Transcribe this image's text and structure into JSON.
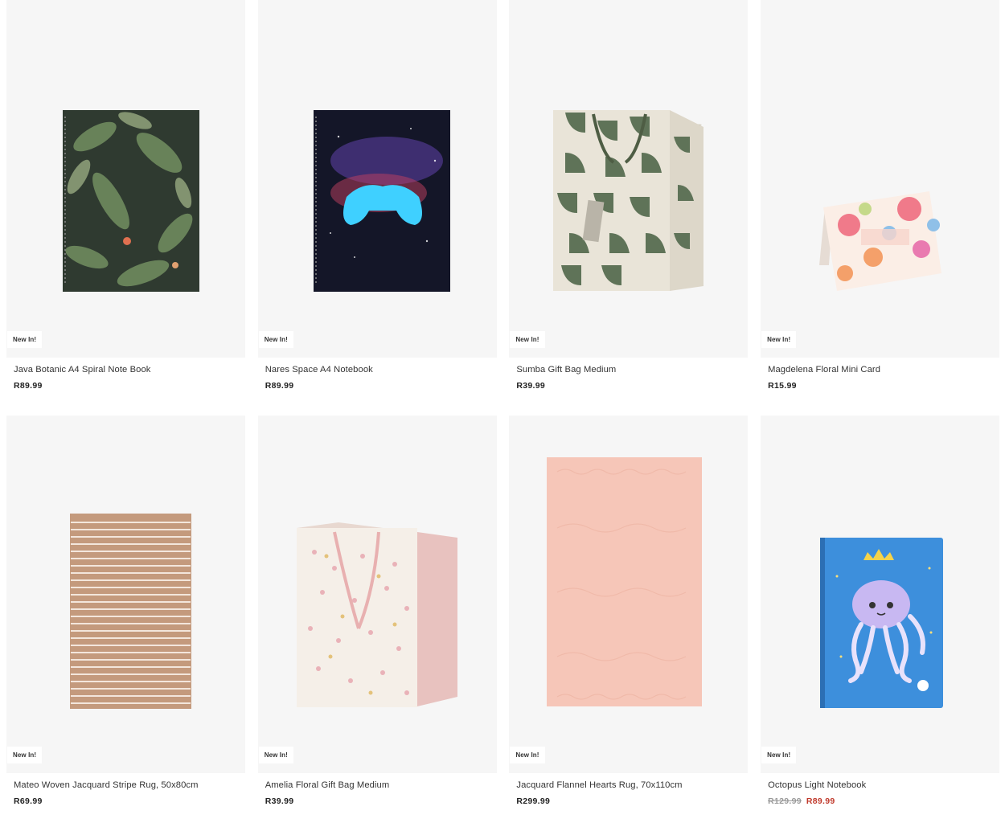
{
  "products": [
    {
      "badge": "New In!",
      "name": "Java Botanic A4 Spiral Note Book",
      "price": "R89.99",
      "was": "",
      "sale": "",
      "image": "botanic-notebook",
      "colors": {
        "cover": "#2f3a30",
        "leaf": "#6f8a5e"
      }
    },
    {
      "badge": "New In!",
      "name": "Nares Space A4 Notebook",
      "price": "R89.99",
      "was": "",
      "sale": "",
      "image": "space-gamepad-notebook",
      "colors": {
        "cover": "#141628",
        "accent": "#3fd0ff"
      }
    },
    {
      "badge": "New In!",
      "name": "Sumba Gift Bag Medium",
      "price": "R39.99",
      "was": "",
      "sale": "",
      "image": "geometric-gift-bag",
      "colors": {
        "base": "#e9e4d8",
        "pattern": "#5f7358"
      }
    },
    {
      "badge": "New In!",
      "name": "Magdelena Floral Mini Card",
      "price": "R15.99",
      "was": "",
      "sale": "",
      "image": "floral-card",
      "colors": {
        "base": "#fbeee6",
        "flower": "#f07a8a"
      }
    },
    {
      "badge": "New In!",
      "name": "Mateo Woven Jacquard Stripe Rug, 50x80cm",
      "price": "R69.99",
      "was": "",
      "sale": "",
      "image": "stripe-rug",
      "colors": {
        "base": "#c49a7d",
        "stripe": "#f3e6dc"
      }
    },
    {
      "badge": "New In!",
      "name": "Amelia Floral Gift Bag Medium",
      "price": "R39.99",
      "was": "",
      "sale": "",
      "image": "floral-gift-bag",
      "colors": {
        "base": "#f5efe8",
        "side": "#e8c2bf"
      }
    },
    {
      "badge": "New In!",
      "name": "Jacquard Flannel Hearts Rug, 70x110cm",
      "price": "R299.99",
      "was": "",
      "sale": "",
      "image": "pink-rug",
      "colors": {
        "base": "#f6c6b8"
      }
    },
    {
      "badge": "New In!",
      "name": "Octopus Light Notebook",
      "price": "",
      "was": "R129.99",
      "sale": "R89.99",
      "image": "octopus-notebook",
      "colors": {
        "base": "#3d8fdc",
        "accent": "#c8b8f2"
      }
    }
  ]
}
